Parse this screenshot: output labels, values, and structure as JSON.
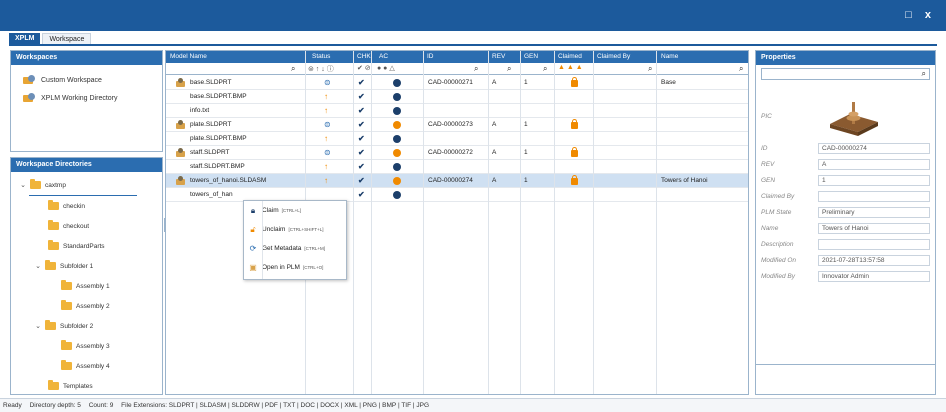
{
  "window": {
    "controls": "□ x"
  },
  "tabs": [
    {
      "label": "XPLM"
    },
    {
      "label": "Workspace"
    }
  ],
  "workspaces": {
    "header": "Workspaces",
    "items": [
      {
        "label": "Custom Workspace"
      },
      {
        "label": "XPLM Working Directory"
      }
    ]
  },
  "directories": {
    "header": "Workspace Directories",
    "tree": [
      {
        "label": "caxtmp",
        "expanded": true
      },
      {
        "label": "checkin"
      },
      {
        "label": "checkout"
      },
      {
        "label": "StandardParts"
      },
      {
        "label": "Subfolder 1",
        "expanded": true
      },
      {
        "label": "Assembly 1"
      },
      {
        "label": "Assembly 2"
      },
      {
        "label": "Subfolder 2",
        "expanded": true
      },
      {
        "label": "Assembly 3"
      },
      {
        "label": "Assembly 4"
      },
      {
        "label": "Templates"
      }
    ]
  },
  "grid": {
    "columns": [
      "Model Name",
      "Status",
      "CHK",
      "AC",
      "ID",
      "REV",
      "GEN",
      "Claimed",
      "Claimed By",
      "Name"
    ],
    "rows": [
      {
        "model": "base.SLDPRT",
        "icon": true,
        "status": "eq",
        "chk": true,
        "ac": "ok",
        "id": "CAD-00000271",
        "rev": "A",
        "gen": "1",
        "claimed": true,
        "name": "Base"
      },
      {
        "model": "base.SLDPRT.BMP",
        "icon": false,
        "status": "up",
        "chk": true,
        "ac": "ok",
        "id": "",
        "rev": "",
        "gen": "",
        "claimed": false,
        "name": ""
      },
      {
        "model": "info.txt",
        "icon": false,
        "status": "up",
        "chk": true,
        "ac": "ok",
        "id": "",
        "rev": "",
        "gen": "",
        "claimed": false,
        "name": ""
      },
      {
        "model": "plate.SLDPRT",
        "icon": true,
        "status": "eq",
        "chk": true,
        "ac": "x",
        "id": "CAD-00000273",
        "rev": "A",
        "gen": "1",
        "claimed": true,
        "name": ""
      },
      {
        "model": "plate.SLDPRT.BMP",
        "icon": false,
        "status": "up",
        "chk": true,
        "ac": "ok",
        "id": "",
        "rev": "",
        "gen": "",
        "claimed": false,
        "name": ""
      },
      {
        "model": "staff.SLDPRT",
        "icon": true,
        "status": "eq",
        "chk": true,
        "ac": "x",
        "id": "CAD-00000272",
        "rev": "A",
        "gen": "1",
        "claimed": true,
        "name": ""
      },
      {
        "model": "staff.SLDPRT.BMP",
        "icon": false,
        "status": "up",
        "chk": true,
        "ac": "ok",
        "id": "",
        "rev": "",
        "gen": "",
        "claimed": false,
        "name": ""
      },
      {
        "model": "towers_of_hanoi.SLDASM",
        "icon": true,
        "status": "up",
        "chk": true,
        "ac": "x",
        "id": "CAD-00000274",
        "rev": "A",
        "gen": "1",
        "claimed": true,
        "name": "Towers of Hanoi",
        "selected": true
      },
      {
        "model": "towers_of_han",
        "icon": false,
        "status": "",
        "chk": true,
        "ac": "ok",
        "id": "",
        "rev": "",
        "gen": "",
        "claimed": false,
        "name": ""
      }
    ]
  },
  "context_menu": [
    {
      "label": "Claim",
      "shortcut": "[CTRL+L]",
      "icon": "lock-icon"
    },
    {
      "label": "Unclaim",
      "shortcut": "[CTRL+SHIFT+L]",
      "icon": "unlock-icon"
    },
    {
      "label": "Get Metadata",
      "shortcut": "[CTRL+M]",
      "icon": "refresh-icon"
    },
    {
      "label": "Open in PLM",
      "shortcut": "[CTRL+O]",
      "icon": "plm-icon"
    }
  ],
  "properties": {
    "header": "Properties",
    "pic_label": "PIC",
    "fields": [
      {
        "label": "ID",
        "value": "CAD-00000274"
      },
      {
        "label": "REV",
        "value": "A"
      },
      {
        "label": "GEN",
        "value": "1"
      },
      {
        "label": "Claimed By",
        "value": ""
      },
      {
        "label": "PLM State",
        "value": "Preliminary"
      },
      {
        "label": "Name",
        "value": "Towers of Hanoi"
      },
      {
        "label": "Description",
        "value": ""
      },
      {
        "label": "Modified On",
        "value": "2021-07-28T13:57:58"
      },
      {
        "label": "Modified By",
        "value": "Innovator Admin"
      }
    ]
  },
  "statusbar": {
    "ready": "Ready",
    "depth": "Directory depth: 5",
    "count": "Count: 9",
    "extensions": "File Extensions: SLDPRT | SLDASM | SLDDRW | PDF | TXT | DOC | DOCX | XML | PNG | BMP | TIF | JPG"
  }
}
